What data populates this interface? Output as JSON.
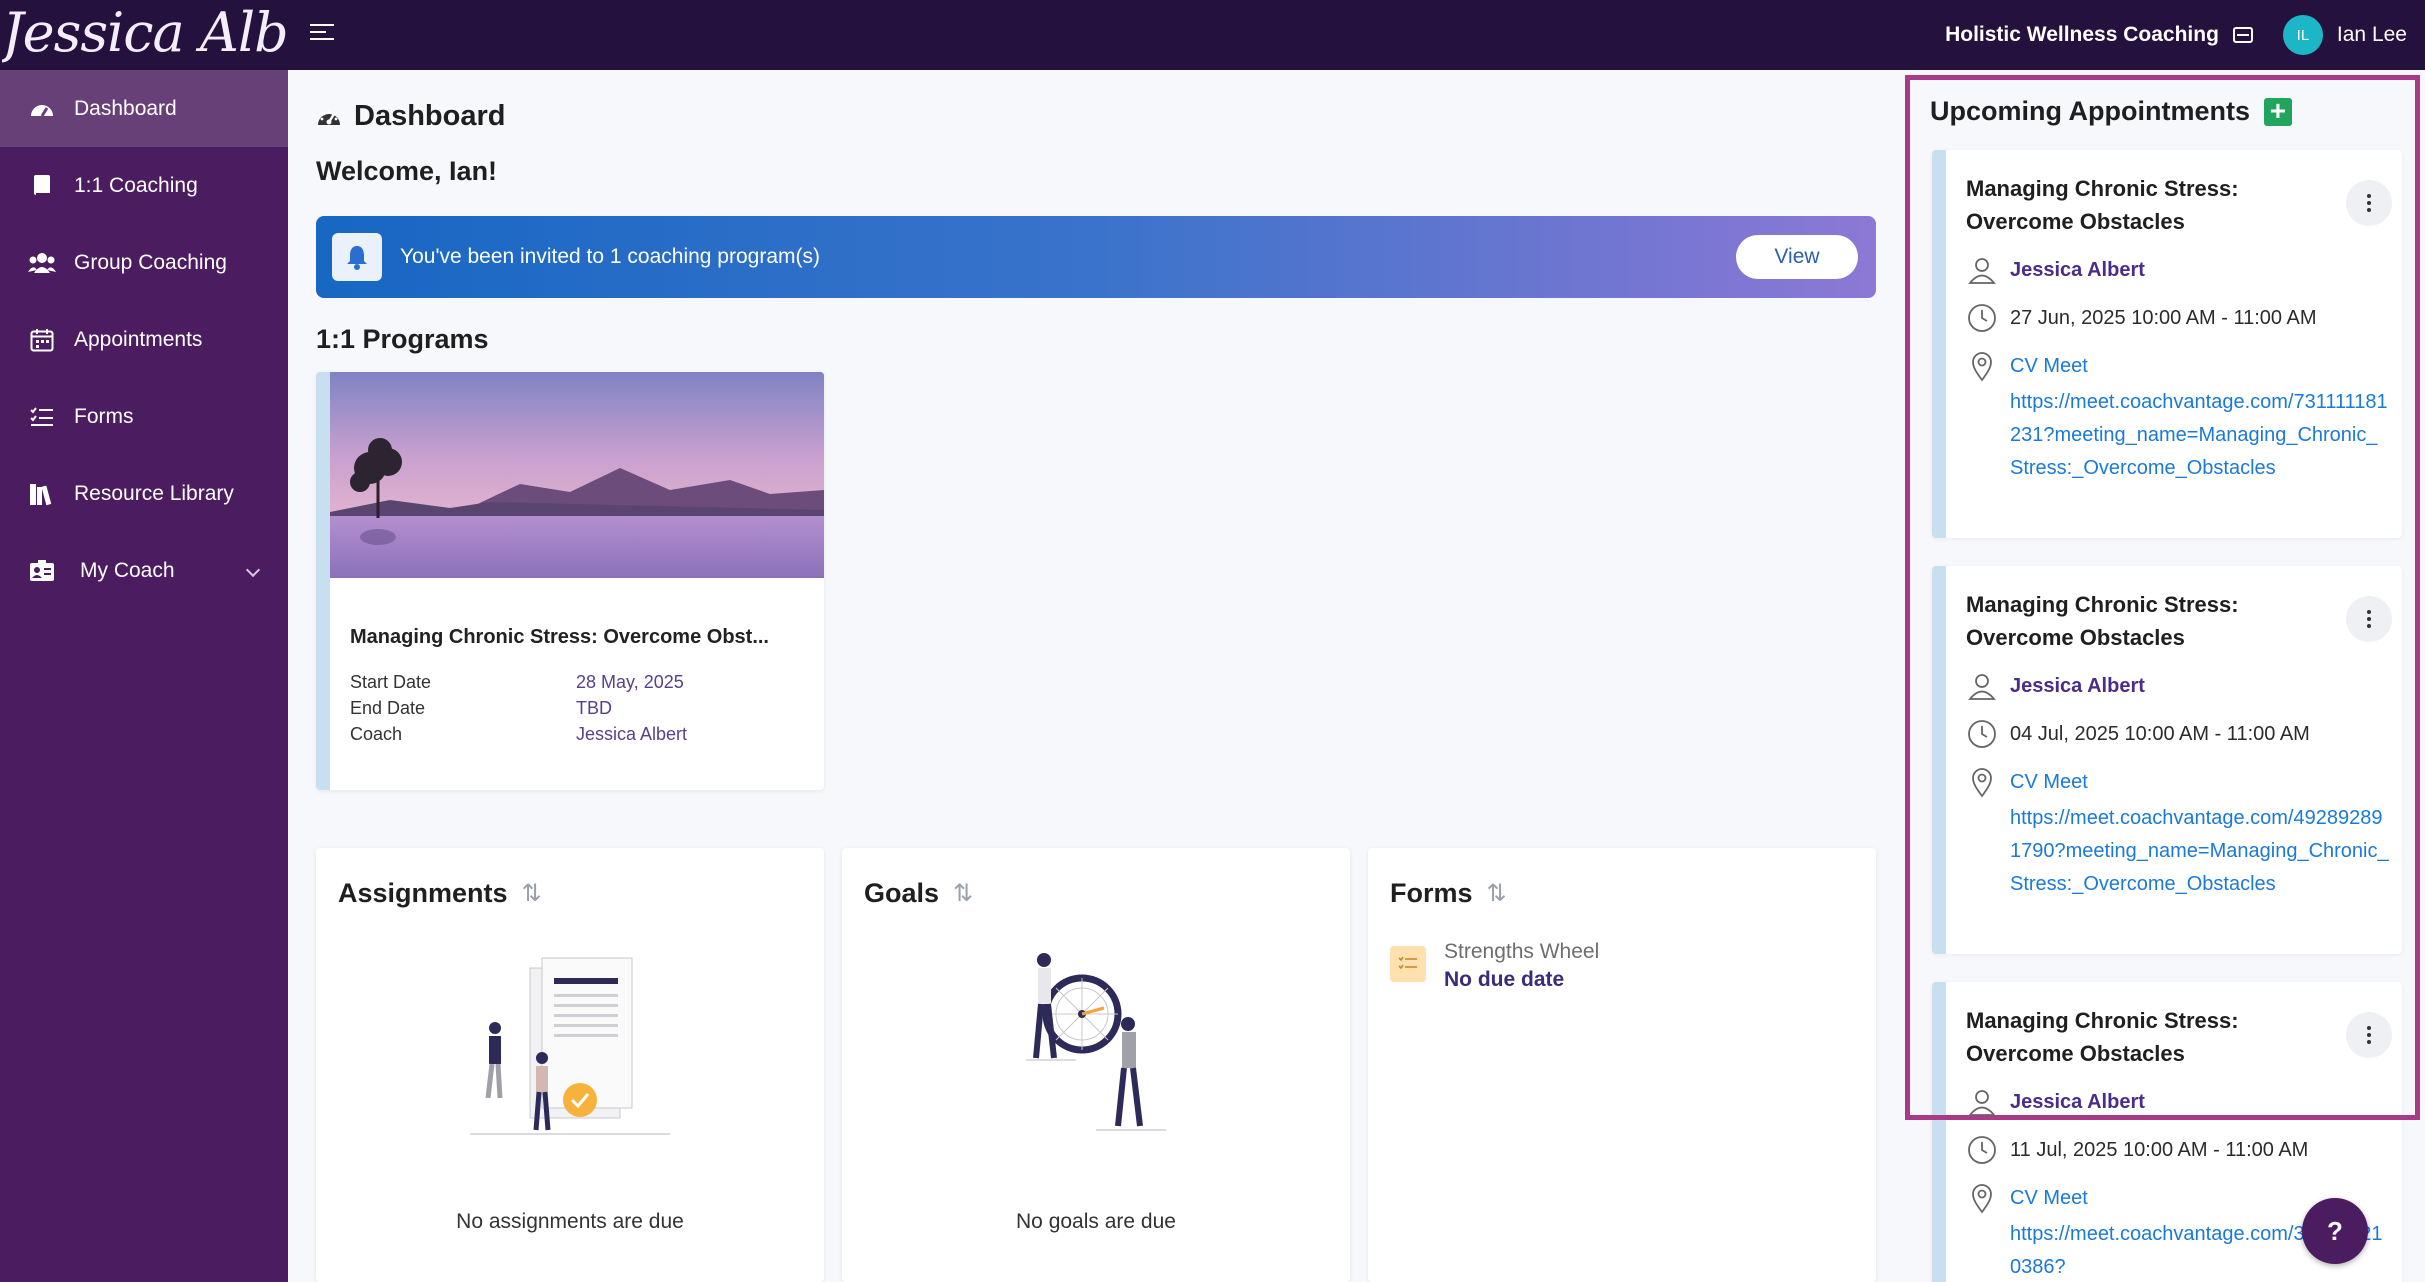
{
  "brand": {
    "logo_text": "Jessica Albert",
    "org_name": "Holistic Wellness Coaching",
    "user_initials": "IL",
    "user_name": "Ian Lee",
    "avatar_color": "#1bb7c6",
    "topbar_color": "#24113e",
    "sidebar_color": "#4b1c5f"
  },
  "sidebar": {
    "items": [
      {
        "label": "Dashboard",
        "icon": "dashboard-gauge-icon",
        "active": true
      },
      {
        "label": "1:1 Coaching",
        "icon": "book-icon"
      },
      {
        "label": "Group Coaching",
        "icon": "users-icon"
      },
      {
        "label": "Appointments",
        "icon": "calendar-icon"
      },
      {
        "label": "Forms",
        "icon": "checklist-icon"
      },
      {
        "label": "Resource Library",
        "icon": "books-icon"
      },
      {
        "label": "My Coach",
        "icon": "coach-card-icon",
        "has_dropdown": true
      }
    ]
  },
  "main": {
    "page_title": "Dashboard",
    "welcome": "Welcome, Ian!",
    "invite": {
      "text": "You've been invited to 1 coaching program(s)",
      "button": "View"
    },
    "programs_title": "1:1 Programs",
    "program": {
      "name": "Managing Chronic Stress: Overcome Obst...",
      "start_label": "Start Date",
      "start_value": "28 May, 2025",
      "end_label": "End Date",
      "end_value": "TBD",
      "coach_label": "Coach",
      "coach_value": "Jessica Albert"
    },
    "assignments": {
      "title": "Assignments",
      "empty": "No assignments are due"
    },
    "goals": {
      "title": "Goals",
      "empty": "No goals are due"
    },
    "forms": {
      "title": "Forms",
      "item_name": "Strengths Wheel",
      "item_due": "No due date"
    }
  },
  "appointments": {
    "title": "Upcoming Appointments",
    "items": [
      {
        "title": "Managing Chronic Stress: Overcome Obstacles",
        "coach": "Jessica Albert",
        "time": "27 Jun, 2025 10:00 AM - 11:00 AM",
        "location": "CV Meet",
        "url": "https://meet.coachvantage.com/731111181231?meeting_name=Managing_Chronic_Stress:_Overcome_Obstacles"
      },
      {
        "title": "Managing Chronic Stress: Overcome Obstacles",
        "coach": "Jessica Albert",
        "time": "04 Jul, 2025 10:00 AM - 11:00 AM",
        "location": "CV Meet",
        "url": "https://meet.coachvantage.com/492892891790?meeting_name=Managing_Chronic_Stress:_Overcome_Obstacles"
      },
      {
        "title": "Managing Chronic Stress: Overcome Obstacles",
        "coach": "Jessica Albert",
        "time": "11 Jul, 2025 10:00 AM - 11:00 AM",
        "location": "CV Meet",
        "url": "https://meet.coachvantage.com/348260210386?"
      }
    ]
  },
  "help": {
    "label": "?"
  }
}
